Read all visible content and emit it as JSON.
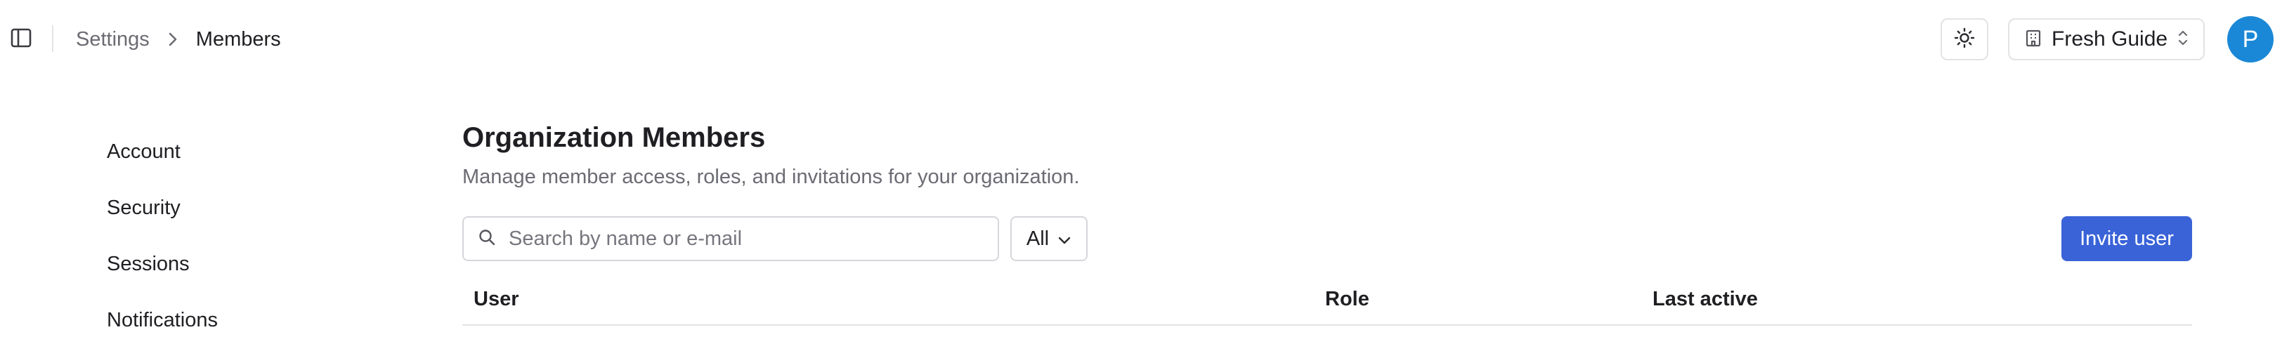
{
  "breadcrumb": {
    "parent": "Settings",
    "current": "Members"
  },
  "header": {
    "theme_icon": "sun-icon",
    "org_switcher": {
      "name": "Fresh Guide",
      "icon": "building-icon"
    },
    "avatar_initial": "P"
  },
  "settings_nav": {
    "items": [
      {
        "label": "Account"
      },
      {
        "label": "Security"
      },
      {
        "label": "Sessions"
      },
      {
        "label": "Notifications"
      }
    ]
  },
  "main": {
    "title": "Organization Members",
    "description": "Manage member access, roles, and invitations for your organization.",
    "search": {
      "placeholder": "Search by name or e-mail",
      "value": ""
    },
    "filter": {
      "selected": "All"
    },
    "invite_label": "Invite user",
    "table": {
      "columns": [
        "User",
        "Role",
        "Last active"
      ]
    }
  },
  "colors": {
    "accent": "#3a63d8",
    "avatar": "#1a88d6",
    "muted_text": "#6b6b73",
    "border": "#e3e3e6"
  }
}
